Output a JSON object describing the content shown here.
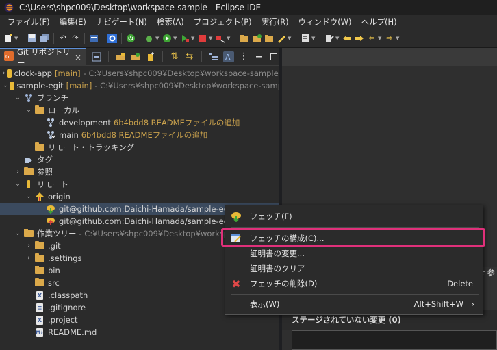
{
  "window": {
    "title": "C:\\Users\\shpc009\\Desktop\\workspace-sample - Eclipse IDE"
  },
  "menubar": [
    "ファイル(F)",
    "編集(E)",
    "ナビゲート(N)",
    "検索(A)",
    "プロジェクト(P)",
    "実行(R)",
    "ウィンドウ(W)",
    "ヘルプ(H)"
  ],
  "view": {
    "tab_label": "Git リポジトリー"
  },
  "tree": {
    "repo1": {
      "name": "clock-app",
      "branch": "[main]",
      "path": "- C:¥Users¥shpc009¥Desktop¥workspace-sample¥clo"
    },
    "repo2": {
      "name": "sample-egit",
      "branch": "[main]",
      "path": "- C:¥Users¥shpc009¥Desktop¥workspace-sample¥s"
    },
    "branches": "ブランチ",
    "local": "ローカル",
    "dev": {
      "name": "development",
      "commit": "6b4bdd8 READMEファイルの追加"
    },
    "main": {
      "name": "main",
      "commit": "6b4bdd8 READMEファイルの追加"
    },
    "remote_tracking": "リモート・トラッキング",
    "tags": "タグ",
    "refs": "参照",
    "remotes": "リモート",
    "origin": "origin",
    "remote_fetch": "git@github.com:Daichi-Hamada/sample-egit",
    "remote_push": "git@github.com:Daichi-Hamada/sample-egit",
    "worktree": {
      "name": "作業ツリー",
      "path": "- C:¥Users¥shpc009¥Desktop¥workspace-s"
    },
    "items": [
      ".git",
      ".settings",
      "bin",
      "src",
      ".classpath",
      ".gitignore",
      ".project",
      "README.md"
    ]
  },
  "context_menu": {
    "fetch": "フェッチ(F)",
    "configure_fetch": "フェッチの構成(C)...",
    "change_cert": "証明書の変更...",
    "clear_cert": "証明書のクリア",
    "delete_fetch": "フェッチの削除(D)",
    "delete_accel": "Delete",
    "show_in": "表示(W)",
    "show_accel": "Alt+Shift+W",
    "submenu_arrow": "›"
  },
  "right": {
    "strip_text": "t 参",
    "unstaged_header": "ステージされていない変更 (0)"
  },
  "colors": {
    "highlight": "#e0307a",
    "branch": "#c8a04c",
    "selection": "#3b4a5e"
  }
}
